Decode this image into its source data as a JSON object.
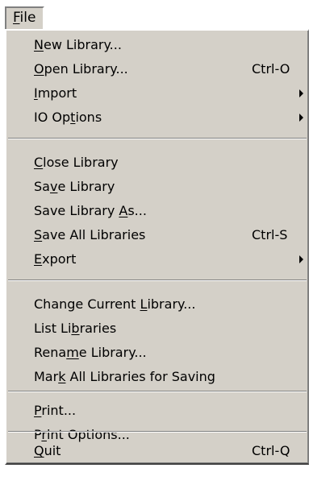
{
  "menubar": {
    "file": {
      "before": "",
      "key": "F",
      "after": "ile"
    }
  },
  "menu": {
    "items": [
      {
        "before": "",
        "key": "N",
        "after": "ew Library...",
        "shortcut": ""
      },
      {
        "before": "",
        "key": "O",
        "after": "pen Library...",
        "shortcut": "Ctrl-O"
      },
      {
        "before": "",
        "key": "I",
        "after": "mport",
        "shortcut": "",
        "submenu": true
      },
      {
        "before": "IO Op",
        "key": "t",
        "after": "ions",
        "shortcut": "",
        "submenu": true
      },
      {
        "before": "",
        "key": "C",
        "after": "lose Library",
        "shortcut": ""
      },
      {
        "before": "Sa",
        "key": "v",
        "after": "e Library",
        "shortcut": ""
      },
      {
        "before": "Save Library ",
        "key": "A",
        "after": "s...",
        "shortcut": ""
      },
      {
        "before": "",
        "key": "S",
        "after": "ave All Libraries",
        "shortcut": "Ctrl-S"
      },
      {
        "before": "",
        "key": "E",
        "after": "xport",
        "shortcut": "",
        "submenu": true
      },
      {
        "before": "Change Current ",
        "key": "L",
        "after": "ibrary...",
        "shortcut": ""
      },
      {
        "before": "List Li",
        "key": "b",
        "after": "raries",
        "shortcut": ""
      },
      {
        "before": "Rena",
        "key": "m",
        "after": "e Library...",
        "shortcut": ""
      },
      {
        "before": "Mar",
        "key": "k",
        "after": " All Libraries for Saving",
        "shortcut": ""
      },
      {
        "before": "",
        "key": "P",
        "after": "rint...",
        "shortcut": ""
      },
      {
        "before": "P",
        "key": "r",
        "after": "int Options...",
        "shortcut": ""
      },
      {
        "before": "",
        "key": "Q",
        "after": "uit",
        "shortcut": "Ctrl-Q"
      }
    ]
  },
  "icons": {
    "submenu_arrow": "submenu-arrow-icon"
  },
  "colors": {
    "menu_background": "#d4d0c8",
    "text": "#000000",
    "shadow": "#808080",
    "highlight": "#ffffff"
  }
}
